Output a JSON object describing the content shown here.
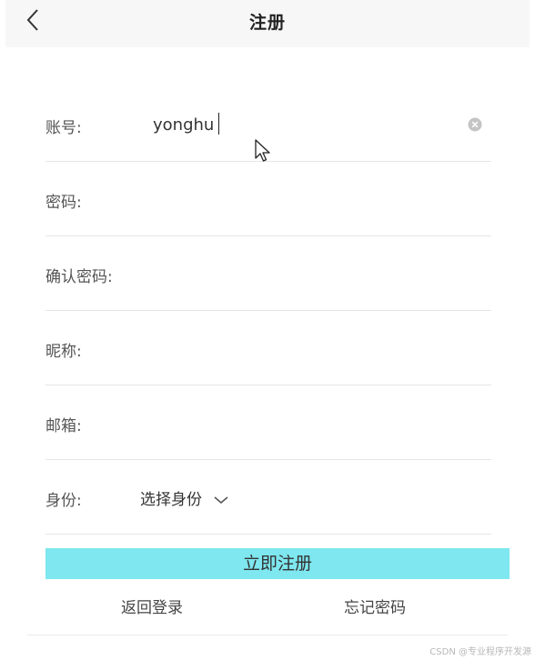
{
  "header": {
    "title": "注册",
    "back_icon": "chevron-left-icon"
  },
  "form": {
    "account": {
      "label": "账号:",
      "value": "yonghu",
      "clear_icon": "clear-circle-icon"
    },
    "password": {
      "label": "密码:",
      "value": ""
    },
    "confirm_password": {
      "label": "确认密码:",
      "value": ""
    },
    "nickname": {
      "label": "昵称:",
      "value": ""
    },
    "email": {
      "label": "邮箱:",
      "value": ""
    },
    "identity": {
      "label": "身份:",
      "selected": "选择身份",
      "dropdown_icon": "chevron-down-icon"
    }
  },
  "actions": {
    "submit_label": "立即注册",
    "back_to_login_label": "返回登录",
    "forgot_password_label": "忘记密码"
  },
  "watermark": "CSDN @专业程序开发源",
  "colors": {
    "submit_background": "#7ee7ef",
    "header_background": "#f7f7f7",
    "divider": "#e6e6e6"
  }
}
